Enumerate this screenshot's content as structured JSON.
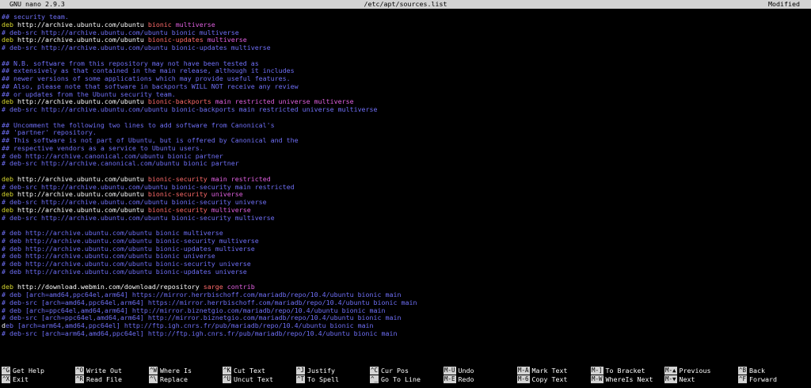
{
  "titlebar": {
    "app": "GNU nano 2.9.3",
    "file": "/etc/apt/sources.list",
    "status": "Modified"
  },
  "colors": {
    "comment": "#6f6ff6",
    "deb": "#d8d82f",
    "distribution": "#ff6b6b",
    "component": "#e060e0",
    "cursor": "#2ad52a",
    "bar": "#d3d3d3"
  },
  "lines": [
    [
      {
        "t": "## security team.",
        "c": "comment"
      }
    ],
    [
      {
        "t": "deb ",
        "c": "deb"
      },
      {
        "t": "http://archive.ubuntu.com/ubuntu ",
        "c": "url"
      },
      {
        "t": "bionic ",
        "c": "dist"
      },
      {
        "t": "multiverse",
        "c": "comp"
      }
    ],
    [
      {
        "t": "# deb-src http://archive.ubuntu.com/ubuntu bionic multiverse",
        "c": "comment"
      }
    ],
    [
      {
        "t": "deb ",
        "c": "deb"
      },
      {
        "t": "http://archive.ubuntu.com/ubuntu ",
        "c": "url"
      },
      {
        "t": "bionic-updates ",
        "c": "dist"
      },
      {
        "t": "multiverse",
        "c": "comp"
      }
    ],
    [
      {
        "t": "# deb-src http://archive.ubuntu.com/ubuntu bionic-updates multiverse",
        "c": "comment"
      }
    ],
    [],
    [
      {
        "t": "## N.B. software from this repository may not have been tested as",
        "c": "comment"
      }
    ],
    [
      {
        "t": "## extensively as that contained in the main release, although it includes",
        "c": "comment"
      }
    ],
    [
      {
        "t": "## newer versions of some applications which may provide useful features.",
        "c": "comment"
      }
    ],
    [
      {
        "t": "## Also, please note that software in backports WILL NOT receive any review",
        "c": "comment"
      }
    ],
    [
      {
        "t": "## or updates from the Ubuntu security team.",
        "c": "comment"
      }
    ],
    [
      {
        "t": "deb ",
        "c": "deb"
      },
      {
        "t": "http://archive.ubuntu.com/ubuntu ",
        "c": "url"
      },
      {
        "t": "bionic-backports ",
        "c": "dist"
      },
      {
        "t": "main restricted universe multiverse",
        "c": "comp"
      }
    ],
    [
      {
        "t": "# deb-src http://archive.ubuntu.com/ubuntu bionic-backports main restricted universe multiverse",
        "c": "comment"
      }
    ],
    [],
    [
      {
        "t": "## Uncomment the following two lines to add software from Canonical's",
        "c": "comment"
      }
    ],
    [
      {
        "t": "## 'partner' repository.",
        "c": "comment"
      }
    ],
    [
      {
        "t": "## This software is not part of Ubuntu, but is offered by Canonical and the",
        "c": "comment"
      }
    ],
    [
      {
        "t": "## respective vendors as a service to Ubuntu users.",
        "c": "comment"
      }
    ],
    [
      {
        "t": "# deb http://archive.canonical.com/ubuntu bionic partner",
        "c": "comment"
      }
    ],
    [
      {
        "t": "# deb-src http://archive.canonical.com/ubuntu bionic partner",
        "c": "comment"
      }
    ],
    [],
    [
      {
        "t": "deb ",
        "c": "deb"
      },
      {
        "t": "http://archive.ubuntu.com/ubuntu ",
        "c": "url"
      },
      {
        "t": "bionic-security ",
        "c": "dist"
      },
      {
        "t": "main restricted",
        "c": "comp"
      }
    ],
    [
      {
        "t": "# deb-src http://archive.ubuntu.com/ubuntu bionic-security main restricted",
        "c": "comment"
      }
    ],
    [
      {
        "t": "deb ",
        "c": "deb"
      },
      {
        "t": "http://archive.ubuntu.com/ubuntu ",
        "c": "url"
      },
      {
        "t": "bionic-security ",
        "c": "dist"
      },
      {
        "t": "universe",
        "c": "comp"
      }
    ],
    [
      {
        "t": "# deb-src http://archive.ubuntu.com/ubuntu bionic-security universe",
        "c": "comment"
      }
    ],
    [
      {
        "t": "deb ",
        "c": "deb"
      },
      {
        "t": "http://archive.ubuntu.com/ubuntu ",
        "c": "url"
      },
      {
        "t": "bionic-security ",
        "c": "dist"
      },
      {
        "t": "multiverse",
        "c": "comp"
      }
    ],
    [
      {
        "t": "# deb-src http://archive.ubuntu.com/ubuntu bionic-security multiverse",
        "c": "comment"
      }
    ],
    [],
    [
      {
        "t": "# deb http://archive.ubuntu.com/ubuntu bionic multiverse",
        "c": "comment"
      }
    ],
    [
      {
        "t": "# deb http://archive.ubuntu.com/ubuntu bionic-security multiverse",
        "c": "comment"
      }
    ],
    [
      {
        "t": "# deb http://archive.ubuntu.com/ubuntu bionic-updates multiverse",
        "c": "comment"
      }
    ],
    [
      {
        "t": "# deb http://archive.ubuntu.com/ubuntu bionic universe",
        "c": "comment"
      }
    ],
    [
      {
        "t": "# deb http://archive.ubuntu.com/ubuntu bionic-security universe",
        "c": "comment"
      }
    ],
    [
      {
        "t": "# deb http://archive.ubuntu.com/ubuntu bionic-updates universe",
        "c": "comment"
      }
    ],
    [],
    [
      {
        "t": "deb ",
        "c": "deb"
      },
      {
        "t": "http://download.webmin.com/download/repository ",
        "c": "url"
      },
      {
        "t": "sarge ",
        "c": "dist"
      },
      {
        "t": "contrib",
        "c": "comp"
      }
    ],
    [
      {
        "t": "# deb [arch=amd64,ppc64el,arm64] https://mirror.herrbischoff.com/mariadb/repo/10.4/ubuntu bionic main",
        "c": "comment"
      }
    ],
    [
      {
        "t": "# deb-src [arch=amd64,ppc64el,arm64] https://mirror.herrbischoff.com/mariadb/repo/10.4/ubuntu bionic main",
        "c": "comment"
      }
    ],
    [
      {
        "t": "# deb [arch=ppc64el,amd64,arm64] http://mirror.biznetgio.com/mariadb/repo/10.4/ubuntu bionic main",
        "c": "comment"
      }
    ],
    [
      {
        "t": "# deb-src [arch=ppc64el,amd64,arm64] http://mirror.biznetgio.com/mariadb/repo/10.4/ubuntu bionic main",
        "c": "comment"
      }
    ],
    [
      {
        "t": "d",
        "c": "cursor"
      },
      {
        "t": "eb [arch=arm64,amd64,ppc64el] http://ftp.igh.cnrs.fr/pub/mariadb/repo/10.4/ubuntu bionic main",
        "c": "comment"
      }
    ],
    [
      {
        "t": "# deb-src [arch=arm64,amd64,ppc64el] http://ftp.igh.cnrs.fr/pub/mariadb/repo/10.4/ubuntu bionic main",
        "c": "comment"
      }
    ]
  ],
  "shortcuts": [
    {
      "key": "^G",
      "label": "Get Help"
    },
    {
      "key": "^O",
      "label": "Write Out"
    },
    {
      "key": "^W",
      "label": "Where Is"
    },
    {
      "key": "^K",
      "label": "Cut Text"
    },
    {
      "key": "^J",
      "label": "Justify"
    },
    {
      "key": "^C",
      "label": "Cur Pos"
    },
    {
      "key": "M-U",
      "label": "Undo"
    },
    {
      "key": "M-A",
      "label": "Mark Text"
    },
    {
      "key": "M-]",
      "label": "To Bracket"
    },
    {
      "key": "M-▲",
      "label": "Previous"
    },
    {
      "key": "^B",
      "label": "Back"
    },
    {
      "key": "^X",
      "label": "Exit"
    },
    {
      "key": "^R",
      "label": "Read File"
    },
    {
      "key": "^\\",
      "label": "Replace"
    },
    {
      "key": "^U",
      "label": "Uncut Text"
    },
    {
      "key": "^T",
      "label": "To Spell"
    },
    {
      "key": "^_",
      "label": "Go To Line"
    },
    {
      "key": "M-E",
      "label": "Redo"
    },
    {
      "key": "M-6",
      "label": "Copy Text"
    },
    {
      "key": "M-W",
      "label": "WhereIs Next"
    },
    {
      "key": "M-▼",
      "label": "Next"
    },
    {
      "key": "^F",
      "label": "Forward"
    }
  ]
}
